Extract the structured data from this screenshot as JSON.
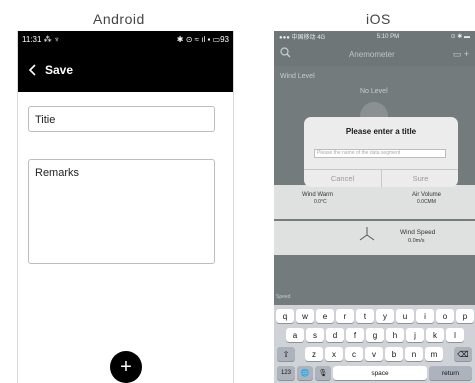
{
  "labels": {
    "android": "Android",
    "ios": "iOS"
  },
  "android": {
    "status": {
      "time": "11:31",
      "icons": "⁂ ♆",
      "right": "✱ ⊙ ≈ ıl ▪ ▭93"
    },
    "appbar": {
      "back_icon": "chevron-left-icon",
      "title": "Save"
    },
    "fields": {
      "title_placeholder": "Titie",
      "remarks_placeholder": "Remarks"
    },
    "fab": {
      "icon": "+"
    }
  },
  "ios": {
    "status": {
      "carrier": "●●● 中国移动 4G",
      "time": "5:10 PM",
      "right": "⊙ ✱ ▬"
    },
    "nav": {
      "title": "Anemometer",
      "search_icon": "search-icon",
      "right_icons": "▭  +"
    },
    "content": {
      "wind_level": "Wind Level",
      "no_level": "No Level",
      "wind_warm": "Wind Warm",
      "wind_warm_value": "0.0°C",
      "air_volume": "Air Volume",
      "air_volume_value": "0.0CMM",
      "wind_speed": "Wind Speed",
      "wind_speed_value": "0.0m/s",
      "speed": "Speed"
    },
    "dialog": {
      "title": "Please enter a title",
      "placeholder": "Please the name of the data segment",
      "cancel": "Cancel",
      "sure": "Sure"
    },
    "keyboard": {
      "row1": [
        "q",
        "w",
        "e",
        "r",
        "t",
        "y",
        "u",
        "i",
        "o",
        "p"
      ],
      "row2": [
        "a",
        "s",
        "d",
        "f",
        "g",
        "h",
        "j",
        "k",
        "l"
      ],
      "row3": [
        "z",
        "x",
        "c",
        "v",
        "b",
        "n",
        "m"
      ],
      "shift": "⇧",
      "delete": "⌫",
      "numbers": "123",
      "globe": "🌐",
      "mic": "🎙",
      "space": "space",
      "return": "return"
    }
  },
  "colors": {
    "android_bar": "#000000",
    "ios_dim": "#6e7678",
    "fab": "#000000"
  }
}
